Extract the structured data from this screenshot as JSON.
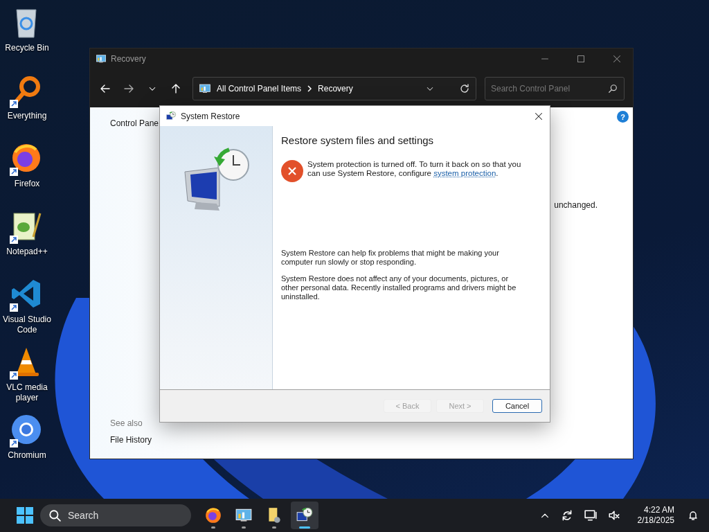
{
  "desktop_icons": [
    {
      "label": "Recycle Bin",
      "kind": "recycle",
      "shortcut": false
    },
    {
      "label": "Everything",
      "kind": "everything",
      "shortcut": true
    },
    {
      "label": "Firefox",
      "kind": "firefox",
      "shortcut": true
    },
    {
      "label": "Notepad++",
      "kind": "notepad",
      "shortcut": true
    },
    {
      "label": "Visual Studio Code",
      "kind": "vscode",
      "shortcut": true
    },
    {
      "label": "VLC media player",
      "kind": "vlc",
      "shortcut": true
    },
    {
      "label": "Chromium",
      "kind": "chromium",
      "shortcut": true
    }
  ],
  "explorer_window": {
    "title": "Recovery",
    "breadcrumb": [
      "All Control Panel Items",
      "Recovery"
    ],
    "search": {
      "placeholder": "Search Control Panel"
    },
    "sidebar_link": "Control Pane",
    "help_label": "?",
    "body_text": "unchanged.",
    "see_also": {
      "heading": "See also",
      "links": [
        "File History"
      ]
    }
  },
  "dialog": {
    "title": "System Restore",
    "heading": "Restore system files and settings",
    "error": {
      "text_before": "System protection is turned off. To turn it back on so that you can use System Restore, configure ",
      "link": "system protection",
      "text_after": "."
    },
    "paragraphs": [
      "System Restore can help fix problems that might be making your computer run slowly or stop responding.",
      "System Restore does not affect any of your documents, pictures, or other personal data. Recently installed programs and drivers might be uninstalled."
    ],
    "buttons": [
      {
        "label": "< Back",
        "disabled": true,
        "default": false
      },
      {
        "label": "Next >",
        "disabled": true,
        "default": false
      },
      {
        "label": "Cancel",
        "disabled": false,
        "default": true
      }
    ]
  },
  "taskbar": {
    "search_placeholder": "Search",
    "apps": [
      {
        "kind": "firefox",
        "selected": false
      },
      {
        "kind": "control-panel",
        "selected": false
      },
      {
        "kind": "file-explorer",
        "selected": false
      },
      {
        "kind": "system-restore",
        "selected": true
      }
    ],
    "time": "4:22 AM",
    "date": "2/18/2025"
  }
}
